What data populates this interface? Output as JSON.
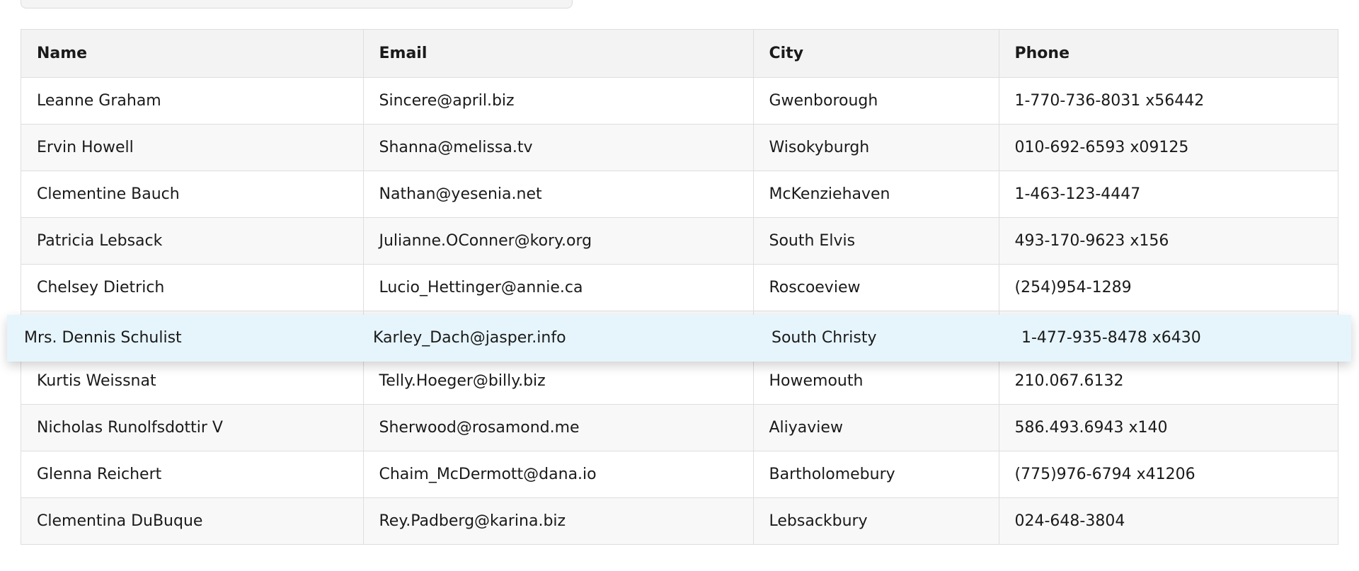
{
  "search": {
    "value": "",
    "placeholder": ""
  },
  "table": {
    "columns": [
      "Name",
      "Email",
      "City",
      "Phone"
    ],
    "rows": [
      {
        "name": "Leanne Graham",
        "email": "Sincere@april.biz",
        "city": "Gwenborough",
        "phone": "1-770-736-8031 x56442"
      },
      {
        "name": "Ervin Howell",
        "email": "Shanna@melissa.tv",
        "city": "Wisokyburgh",
        "phone": "010-692-6593 x09125"
      },
      {
        "name": "Clementine Bauch",
        "email": "Nathan@yesenia.net",
        "city": "McKenziehaven",
        "phone": "1-463-123-4447"
      },
      {
        "name": "Patricia Lebsack",
        "email": "Julianne.OConner@kory.org",
        "city": "South Elvis",
        "phone": "493-170-9623 x156"
      },
      {
        "name": "Chelsey Dietrich",
        "email": "Lucio_Hettinger@annie.ca",
        "city": "Roscoeview",
        "phone": "(254)954-1289"
      },
      {
        "name": "",
        "email": "",
        "city": "",
        "phone": ""
      },
      {
        "name": "Kurtis Weissnat",
        "email": "Telly.Hoeger@billy.biz",
        "city": "Howemouth",
        "phone": "210.067.6132"
      },
      {
        "name": "Nicholas Runolfsdottir V",
        "email": "Sherwood@rosamond.me",
        "city": "Aliyaview",
        "phone": "586.493.6943 x140"
      },
      {
        "name": "Glenna Reichert",
        "email": "Chaim_McDermott@dana.io",
        "city": "Bartholomebury",
        "phone": "(775)976-6794 x41206"
      },
      {
        "name": "Clementina DuBuque",
        "email": "Rey.Padberg@karina.biz",
        "city": "Lebsackbury",
        "phone": "024-648-3804"
      }
    ],
    "dragged_row": {
      "name": "Mrs. Dennis Schulist",
      "email": "Karley_Dach@jasper.info",
      "city": "South Christy",
      "phone": "1-477-935-8478 x6430"
    }
  },
  "colors": {
    "header_bg": "#f3f3f3",
    "border": "#dedede",
    "drag_highlight": "#e6f5fc"
  }
}
